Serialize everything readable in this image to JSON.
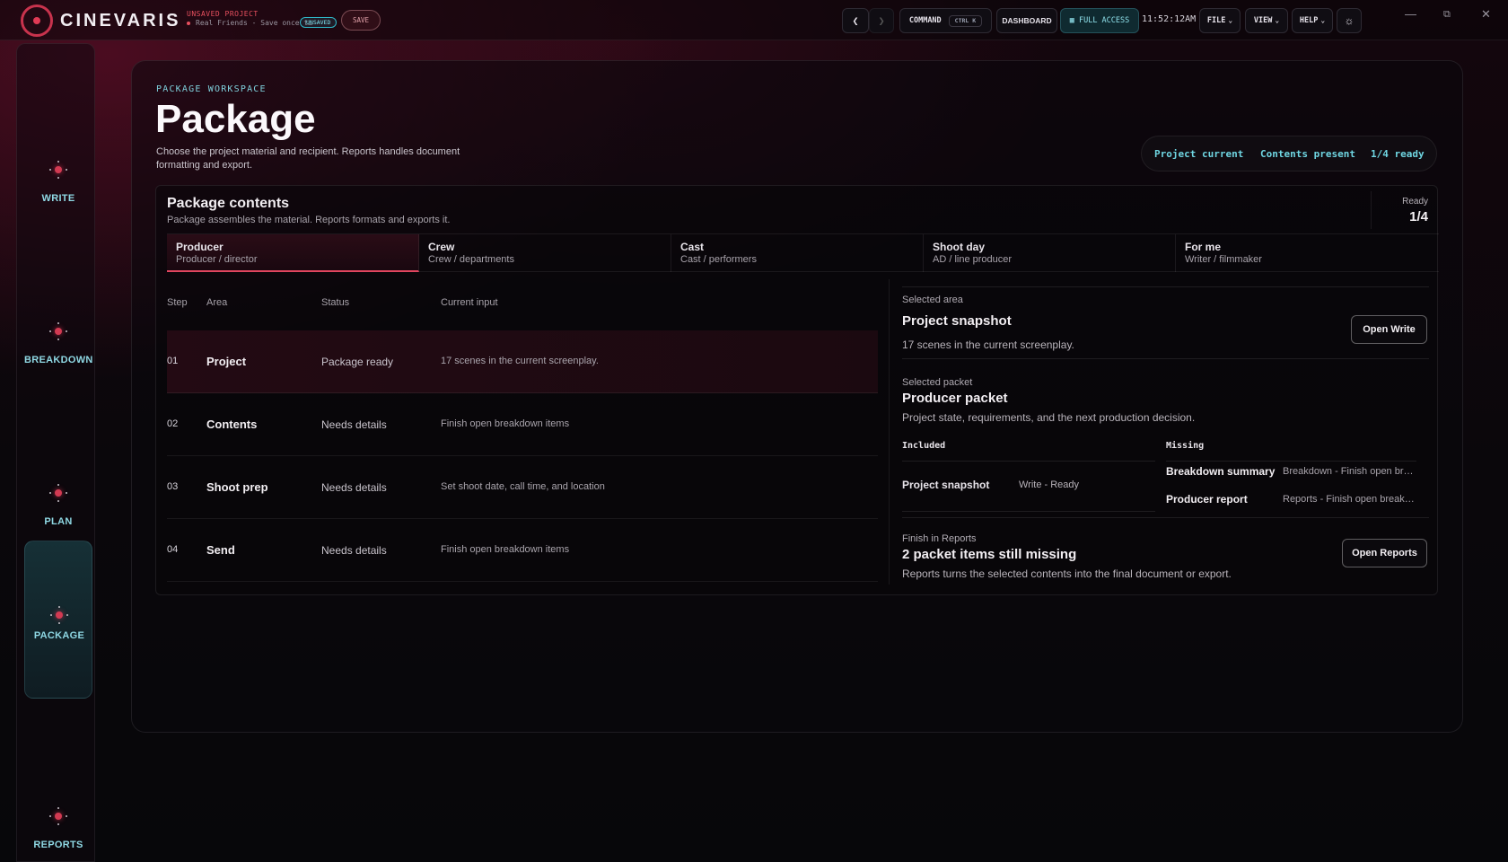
{
  "app": {
    "brand": "CINEVARIS",
    "project_label": "UNSAVED PROJECT",
    "project_name": "Real Friends - Save once t…",
    "unsaved_badge": "UNSAVED",
    "save_label": "SAVE"
  },
  "topbar": {
    "command_label": "COMMAND",
    "command_shortcut": "CTRL K",
    "dashboard_label": "DASHBOARD",
    "access_label": "FULL ACCESS",
    "clock": "11:52:12AM",
    "file_label": "FILE",
    "view_label": "VIEW",
    "help_label": "HELP"
  },
  "rail": {
    "items": [
      {
        "label": "WRITE"
      },
      {
        "label": "BREAKDOWN"
      },
      {
        "label": "PLAN"
      },
      {
        "label": "PACKAGE"
      },
      {
        "label": "REPORTS"
      }
    ],
    "active": "PACKAGE"
  },
  "workspace": {
    "eyebrow": "PACKAGE WORKSPACE",
    "title": "Package",
    "description": "Choose the project material and recipient. Reports handles document formatting and export.",
    "status": [
      "Project current",
      "Contents present",
      "1/4 ready"
    ]
  },
  "contents": {
    "title": "Package contents",
    "subtitle": "Package assembles the material. Reports formats and exports it.",
    "ready_label": "Ready",
    "ready_value": "1/4",
    "tabs": [
      {
        "name": "Producer",
        "role": "Producer / director"
      },
      {
        "name": "Crew",
        "role": "Crew / departments"
      },
      {
        "name": "Cast",
        "role": "Cast / performers"
      },
      {
        "name": "Shoot day",
        "role": "AD / line producer"
      },
      {
        "name": "For me",
        "role": "Writer / filmmaker"
      }
    ],
    "columns": [
      "Step",
      "Area",
      "Status",
      "Current input"
    ],
    "rows": [
      {
        "step": "01",
        "area": "Project",
        "status": "Package ready",
        "input": "17 scenes in the current screenplay."
      },
      {
        "step": "02",
        "area": "Contents",
        "status": "Needs details",
        "input": "Finish open breakdown items"
      },
      {
        "step": "03",
        "area": "Shoot prep",
        "status": "Needs details",
        "input": "Set shoot date, call time, and location"
      },
      {
        "step": "04",
        "area": "Send",
        "status": "Needs details",
        "input": "Finish open breakdown items"
      }
    ]
  },
  "detail": {
    "selected_area_label": "Selected area",
    "selected_area_title": "Project snapshot",
    "selected_area_text": "17 scenes in the current screenplay.",
    "open_write_label": "Open Write",
    "selected_packet_label": "Selected packet",
    "selected_packet_title": "Producer packet",
    "selected_packet_text": "Project state, requirements, and the next production decision.",
    "included_label": "Included",
    "missing_label": "Missing",
    "included": [
      {
        "name": "Project snapshot",
        "value": "Write - Ready"
      }
    ],
    "missing": [
      {
        "name": "Breakdown summary",
        "value": "Breakdown - Finish open br…"
      },
      {
        "name": "Producer report",
        "value": "Reports - Finish open break…"
      }
    ],
    "finish_label": "Finish in Reports",
    "finish_title": "2 packet items still missing",
    "finish_text": "Reports turns the selected contents into the final document or export.",
    "open_reports_label": "Open Reports"
  }
}
